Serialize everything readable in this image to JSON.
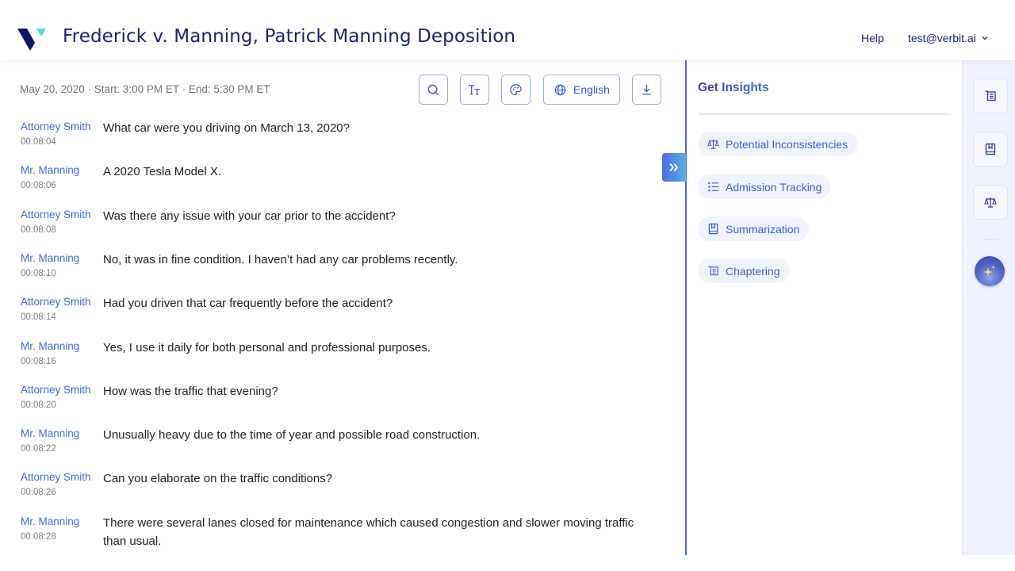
{
  "header": {
    "title": "Frederick v. Manning, Patrick Manning Deposition",
    "help_label": "Help",
    "user_email": "test@verbit.ai",
    "logo_icon": "verbit-logo",
    "user_menu_icon": "chevron-down-icon"
  },
  "session": {
    "meta": "May 20, 2020 · Start: 3:00 PM ET · End: 5:30 PM ET"
  },
  "toolbar": {
    "search_icon": "search-icon",
    "font_size_icon": "text-size-icon",
    "theme_icon": "palette-icon",
    "language_icon": "globe-icon",
    "language_label": "English",
    "download_icon": "download-icon"
  },
  "transcript": [
    {
      "speaker": "Attorney Smith",
      "time": "00:08:04",
      "text": "What car were you driving on March 13, 2020?"
    },
    {
      "speaker": "Mr. Manning",
      "time": "00:08:06",
      "text": "A 2020 Tesla Model X."
    },
    {
      "speaker": "Attorney Smith",
      "time": "00:08:08",
      "text": "Was there any issue with your car prior to the accident?"
    },
    {
      "speaker": "Mr. Manning",
      "time": "00:08:10",
      "text": "No, it was in fine condition. I haven’t had any car problems recently."
    },
    {
      "speaker": "Attorney Smith",
      "time": "00:08:14",
      "text": "Had you driven that car frequently before the accident?"
    },
    {
      "speaker": "Mr. Manning",
      "time": "00:08:16",
      "text": "Yes, I use it daily for both personal and professional purposes."
    },
    {
      "speaker": "Attorney Smith",
      "time": "00:08:20",
      "text": "How was the traffic that evening?"
    },
    {
      "speaker": "Mr. Manning",
      "time": "00:08:22",
      "text": "Unusually heavy due to the time of year and possible road construction."
    },
    {
      "speaker": "Attorney Smith",
      "time": "00:08:26",
      "text": "Can you elaborate on the traffic conditions?"
    },
    {
      "speaker": "Mr. Manning",
      "time": "00:08:28",
      "text": "There were several lanes closed for maintenance which caused congestion and slower moving traffic than usual."
    }
  ],
  "panel": {
    "collapse_icon": "double-chevron-right-icon",
    "title": "Get Insights",
    "insights": [
      {
        "label": "Potential Inconsistencies",
        "icon": "scales-icon"
      },
      {
        "label": "Admission Tracking",
        "icon": "checklist-icon"
      },
      {
        "label": "Summarization",
        "icon": "book-icon"
      },
      {
        "label": "Chaptering",
        "icon": "scroll-icon"
      }
    ]
  },
  "rail": {
    "buttons": [
      {
        "icon": "scroll-icon",
        "label": "Chaptering"
      },
      {
        "icon": "book-icon",
        "label": "Summarization"
      },
      {
        "icon": "scales-icon",
        "label": "Potential Inconsistencies"
      }
    ],
    "ai_icon": "sparkle-icon"
  },
  "colors": {
    "brand_navy": "#1a2470",
    "brand_teal": "#4fd8cf",
    "accent_blue": "#3f6ae0",
    "divider_blue": "#4a6ae6",
    "rail_bg": "#f0f3fd"
  }
}
